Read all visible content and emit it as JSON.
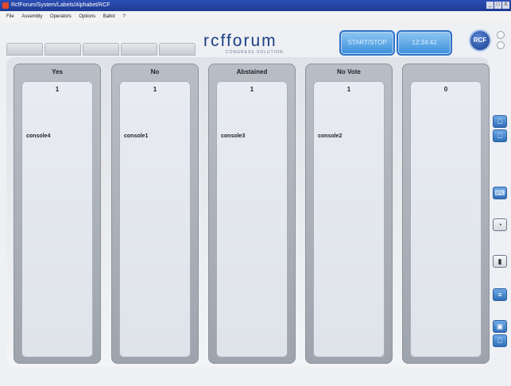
{
  "window": {
    "title": "RcfForum/System/Labels/Alphabet/RCF",
    "controls": [
      "_",
      "□",
      "X"
    ]
  },
  "menu": {
    "items": [
      "File",
      "Assembly",
      "Operators",
      "Options",
      "Ballot",
      "?"
    ]
  },
  "branding": {
    "logo_text": "rcfforum",
    "subtitle": "CONGRESS SOLUTION"
  },
  "top_buttons": [
    {
      "label": "START/STOP"
    },
    {
      "label": "12:34:42"
    }
  ],
  "columns": [
    {
      "title": "Yes",
      "count": "1",
      "item": "console4"
    },
    {
      "title": "No",
      "count": "1",
      "item": "console1"
    },
    {
      "title": "Abstained",
      "count": "1",
      "item": "console3"
    },
    {
      "title": "No Vote",
      "count": "1",
      "item": "console2"
    },
    {
      "title": "",
      "count": "0",
      "item": ""
    }
  ],
  "right_toolbar": [
    {
      "icon": "small-blue-icon"
    },
    {
      "icon": "small-blue-icon"
    },
    {
      "icon": "keyboard-icon"
    },
    {
      "icon": "pie-chart-icon"
    },
    {
      "icon": "bar-chart-icon"
    },
    {
      "icon": "list-icon"
    },
    {
      "icon": "monitor-icon"
    },
    {
      "icon": "small-blue-icon"
    }
  ]
}
